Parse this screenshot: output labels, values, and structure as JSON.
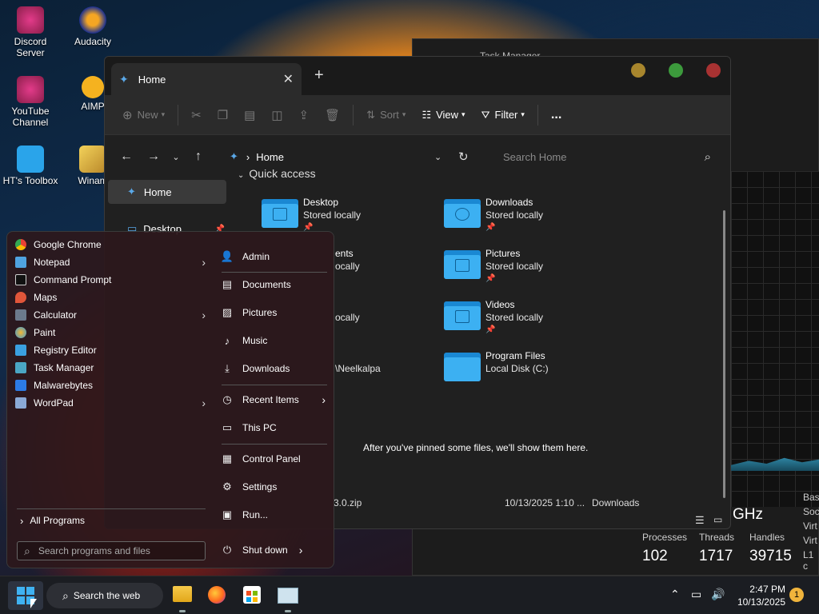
{
  "desktop": {
    "icons": [
      {
        "label": "Discord Server"
      },
      {
        "label": "Audacity"
      },
      {
        "label": "YouTube Channel"
      },
      {
        "label": "AIMP"
      },
      {
        "label": "HT's Toolbox"
      },
      {
        "label": "Winam"
      }
    ]
  },
  "taskmgr": {
    "title": "Task Manager",
    "ghz": "GHz",
    "processes_label": "Processes",
    "threads_label": "Threads",
    "handles_label": "Handles",
    "processes": "102",
    "threads": "1717",
    "handles": "39715",
    "side": [
      "Bas",
      "Soc",
      "Virt",
      "Virt",
      "L1 c"
    ]
  },
  "explorer": {
    "tab_title": "Home",
    "toolbar": {
      "new": "New",
      "sort": "Sort",
      "view": "View",
      "filter": "Filter",
      "more": "..."
    },
    "address": "Home",
    "search_placeholder": "Search Home",
    "nav": [
      {
        "label": "Home"
      },
      {
        "label": "Desktop"
      }
    ],
    "quick_access": "Quick access",
    "folders": [
      {
        "name": "Desktop",
        "sub": "Stored locally"
      },
      {
        "name": "Downloads",
        "sub": "Stored locally"
      },
      {
        "name": "ents",
        "sub": "ocally"
      },
      {
        "name": "Pictures",
        "sub": "Stored locally"
      },
      {
        "name": "",
        "sub": "ocally"
      },
      {
        "name": "Videos",
        "sub": "Stored locally"
      },
      {
        "name": "",
        "sub": "\\Neelkalpa"
      },
      {
        "name": "Program Files",
        "sub": "Local Disk (C:)"
      }
    ],
    "empty_message": "After you've pinned some files, we'll show them here.",
    "recent": {
      "file": "3.0.zip",
      "date": "10/13/2025 1:10 ...",
      "location": "Downloads"
    }
  },
  "start_menu": {
    "programs": [
      {
        "label": "Google Chrome",
        "color": "#e94235",
        "submenu": false
      },
      {
        "label": "Notepad",
        "color": "#4fa3e0",
        "submenu": true
      },
      {
        "label": "Command Prompt",
        "color": "#cfcfcf",
        "submenu": false
      },
      {
        "label": "Maps",
        "color": "#e0563a",
        "submenu": false
      },
      {
        "label": "Calculator",
        "color": "#6b7a8c",
        "submenu": true
      },
      {
        "label": "Paint",
        "color": "#f2b632",
        "submenu": false
      },
      {
        "label": "Registry Editor",
        "color": "#3aa0e0",
        "submenu": false
      },
      {
        "label": "Task Manager",
        "color": "#4aa6c4",
        "submenu": false
      },
      {
        "label": "Malwarebytes",
        "color": "#2c7be5",
        "submenu": false
      },
      {
        "label": "WordPad",
        "color": "#8aa9d6",
        "submenu": true
      }
    ],
    "all_programs": "All Programs",
    "search_placeholder": "Search programs and files",
    "places": [
      {
        "label": "Admin",
        "icon": "user-icon"
      },
      {
        "label": "Documents",
        "icon": "document-icon"
      },
      {
        "label": "Pictures",
        "icon": "image-icon"
      },
      {
        "label": "Music",
        "icon": "music-icon"
      },
      {
        "label": "Downloads",
        "icon": "download-icon"
      },
      {
        "label": "Recent Items",
        "icon": "clock-icon"
      },
      {
        "label": "This PC",
        "icon": "computer-icon"
      },
      {
        "label": "Control Panel",
        "icon": "control-panel-icon"
      },
      {
        "label": "Settings",
        "icon": "gear-icon"
      },
      {
        "label": "Run...",
        "icon": "run-icon"
      }
    ],
    "shutdown": "Shut down"
  },
  "taskbar": {
    "search_label": "Search the web",
    "time": "2:47 PM",
    "date": "10/13/2025",
    "notification_count": "1"
  }
}
